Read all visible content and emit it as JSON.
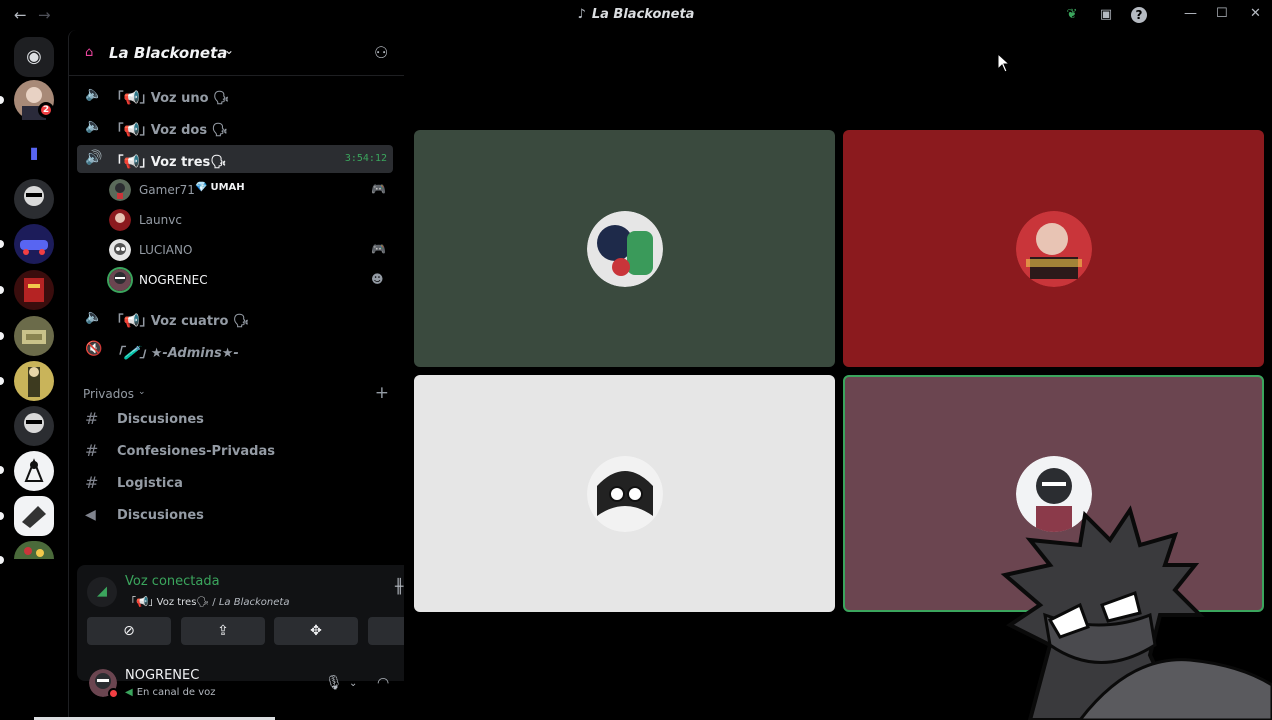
{
  "window": {
    "title": "La Blackoneta",
    "back_icon": "←",
    "forward_icon": "→",
    "title_icon": "♪",
    "leaf_icon": "❦",
    "inbox_icon": "▣",
    "help_icon": "?",
    "minimize_icon": "—",
    "maximize_icon": "☐",
    "close_icon": "✕"
  },
  "rail": {
    "home_icon": "◉",
    "badge_count": "2",
    "folder_icon": "▮"
  },
  "guild": {
    "name": "La Blackoneta",
    "chevron": "⌄",
    "icon": "⌂",
    "invite_icon": "⚇"
  },
  "channels": [
    {
      "icon": "🔈",
      "name": "｢📢｣ Voz uno 🗣",
      "time": ""
    },
    {
      "icon": "🔈",
      "name": "｢📢｣ Voz dos 🗣",
      "time": ""
    },
    {
      "icon": "🔊",
      "name": "｢📢｣ Voz tres🗣",
      "time": "3:54:12"
    },
    {
      "icon": "🔈",
      "name": "｢📢｣ Voz cuatro 🗣",
      "time": ""
    },
    {
      "icon": "🔇",
      "name": "｢🧪｣ ★-Admins★-",
      "time": ""
    }
  ],
  "voice_users": [
    {
      "name": "Gamer71",
      "tag_icon": "💎",
      "tag": "UMAH",
      "indicator": "🎮"
    },
    {
      "name": "Launvc",
      "tag_icon": "",
      "tag": "",
      "indicator": ""
    },
    {
      "name": "LUCIANO",
      "tag_icon": "",
      "tag": "",
      "indicator": "🎮"
    },
    {
      "name": "NOGRENEC",
      "tag_icon": "",
      "tag": "",
      "indicator": "☻"
    }
  ],
  "category": {
    "name": "Privados",
    "chevron": "⌄",
    "add_icon": "+"
  },
  "text_channels": [
    {
      "icon": "#",
      "name": "Discusiones"
    },
    {
      "icon": "#",
      "name": "Confesiones-Privadas"
    },
    {
      "icon": "#",
      "name": "Logistica"
    },
    {
      "icon": "◀",
      "name": "Discusiones"
    }
  ],
  "voice_panel": {
    "status": "Voz conectada",
    "channel": "｢📢｣ Voz tres🗣",
    "separator": " / ",
    "server": "La Blackoneta",
    "signal_icon": "◢",
    "waves_icon": "╫",
    "hangup_icon": "☎",
    "buttons": [
      {
        "icon": "⊘"
      },
      {
        "icon": "⇪"
      },
      {
        "icon": "✥"
      },
      {
        "icon": "✺"
      }
    ]
  },
  "user_panel": {
    "name": "NOGRENEC",
    "status": "En canal de voz",
    "status_icon": "◀",
    "mic_icon": "🎙",
    "headset_icon": "◠",
    "chevron": "⌄",
    "settings_icon": "⚙"
  },
  "colors": {
    "accent_green": "#3ba55d",
    "blurple": "#5865f2",
    "danger": "#f23f43"
  }
}
